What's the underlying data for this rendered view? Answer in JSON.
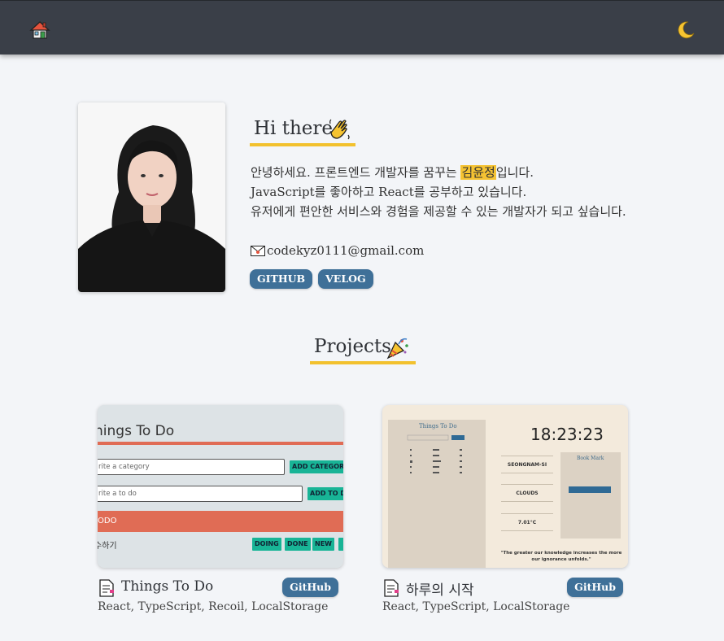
{
  "header": {
    "home_icon": "house-icon",
    "theme_icon": "crescent-moon-icon"
  },
  "profile": {
    "greeting": "Hi there",
    "greeting_emoji": "waving-hand-icon",
    "intro_line1_prefix": "안녕하세요. 프론트엔드 개발자를 꿈꾸는 ",
    "name": "김윤정",
    "intro_line1_suffix": "입니다.",
    "intro_line2": "JavaScript를 좋아하고 React를 공부하고 있습니다.",
    "intro_line3": "유저에게 편안한 서비스와 경험을 제공할 수 있는 개발자가 되고 싶습니다.",
    "email": "codekyz0111@gmail.com",
    "links": [
      {
        "label": "GITHUB"
      },
      {
        "label": "VELOG"
      }
    ]
  },
  "projects": {
    "title": "Projects",
    "title_emoji": "party-popper-icon",
    "items": [
      {
        "name": "Things To Do",
        "button": "GitHub",
        "stack": "React, TypeScript, Recoil, LocalStorage",
        "preview": {
          "heading": "hings To Do",
          "category_placeholder": "rite a category",
          "category_button": "ADD CATEGORY",
          "todo_placeholder": "rite a to do",
          "todo_button": "ADD TO DO",
          "section": "ODO",
          "item": "수하기",
          "actions": [
            "DOING",
            "DONE",
            "NEW"
          ]
        }
      },
      {
        "name": "하루의 시작",
        "button": "GitHub",
        "stack": "React, TypeScript, LocalStorage",
        "preview": {
          "todo_title": "Things To Do",
          "clock": "18:23:23",
          "city": "SEONGNAM-SI",
          "weather": "CLOUDS",
          "temp": "7.01°C",
          "bookmark": "Book Mark",
          "quote": "\"The greater our knowledge increases the more our ignorance unfolds.\""
        }
      }
    ]
  },
  "colors": {
    "header_bg": "#3a3f48",
    "accent_underline": "#f2c12e",
    "button_bg": "#3f7098",
    "highlight": "#f5c332",
    "page_bg": "#f3f5f8"
  }
}
